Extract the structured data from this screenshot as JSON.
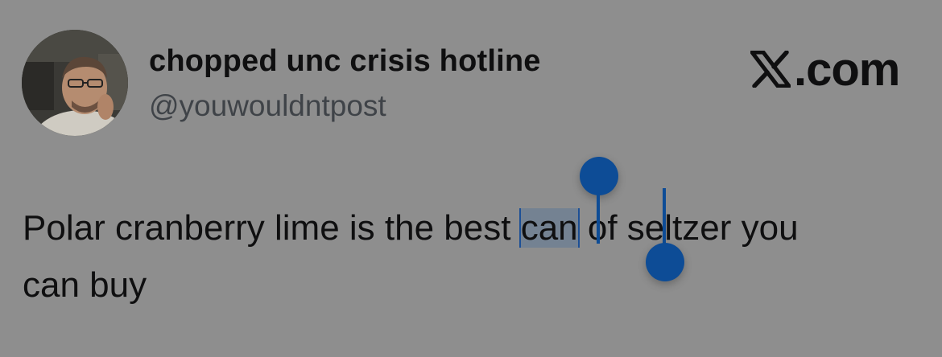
{
  "post": {
    "author": {
      "display_name": "chopped unc crisis hotline",
      "handle": "@youwouldntpost"
    },
    "brand": {
      "text": ".com",
      "logo_icon": "x-logo-icon"
    },
    "text": {
      "line1_before": "Polar cranberry lime is the best ",
      "selected": "can",
      "line1_after": " of seltzer you",
      "line2": "can buy"
    }
  },
  "colors": {
    "background": "#8e8e8e",
    "text": "#0f0f10",
    "handle_text": "#3f4348",
    "selection_handle": "#0d4c96",
    "selection_highlight": "#5f7896"
  }
}
